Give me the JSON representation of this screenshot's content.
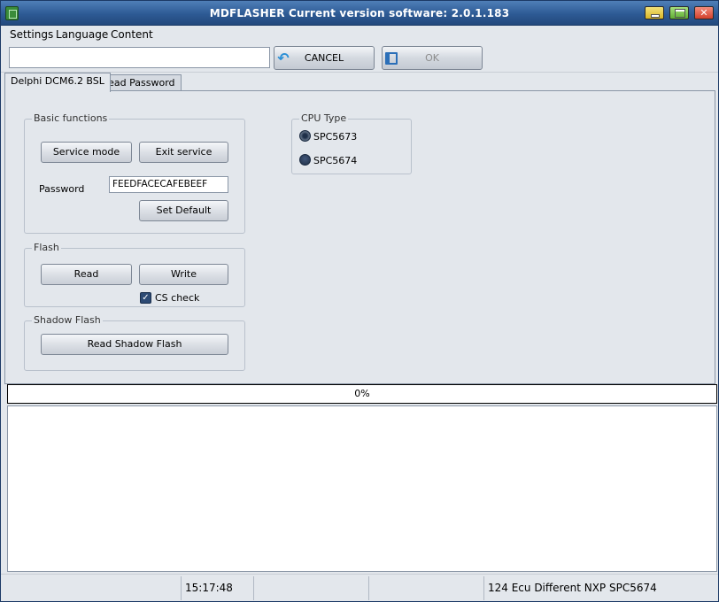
{
  "window": {
    "title": "MDFLASHER  Current version software: 2.0.1.183"
  },
  "menu": [
    "Settings",
    "Language",
    "Content"
  ],
  "toolbar": {
    "input_value": "",
    "cancel_label": "CANCEL",
    "ok_label": "OK"
  },
  "tabs": [
    "Delphi DCM6.2  BSL",
    "Read Password"
  ],
  "basic_functions": {
    "label": "Basic functions",
    "service_mode": "Service mode",
    "exit_service": "Exit service",
    "password_label": "Password",
    "password_value": "FEEDFACECAFEBEEF",
    "set_default": "Set Default"
  },
  "flash": {
    "label": "Flash",
    "read": "Read",
    "write": "Write",
    "cs_check": "CS check",
    "cs_checked": true
  },
  "shadow_flash": {
    "label": "Shadow Flash",
    "read_shadow": "Read Shadow Flash"
  },
  "cpu_type": {
    "label": "CPU Type",
    "options": [
      "SPC5673",
      "SPC5674"
    ]
  },
  "progress": {
    "text": "0%",
    "value": 0
  },
  "status": {
    "time": "15:17:48",
    "info": "124 Ecu Different NXP SPC5674"
  }
}
